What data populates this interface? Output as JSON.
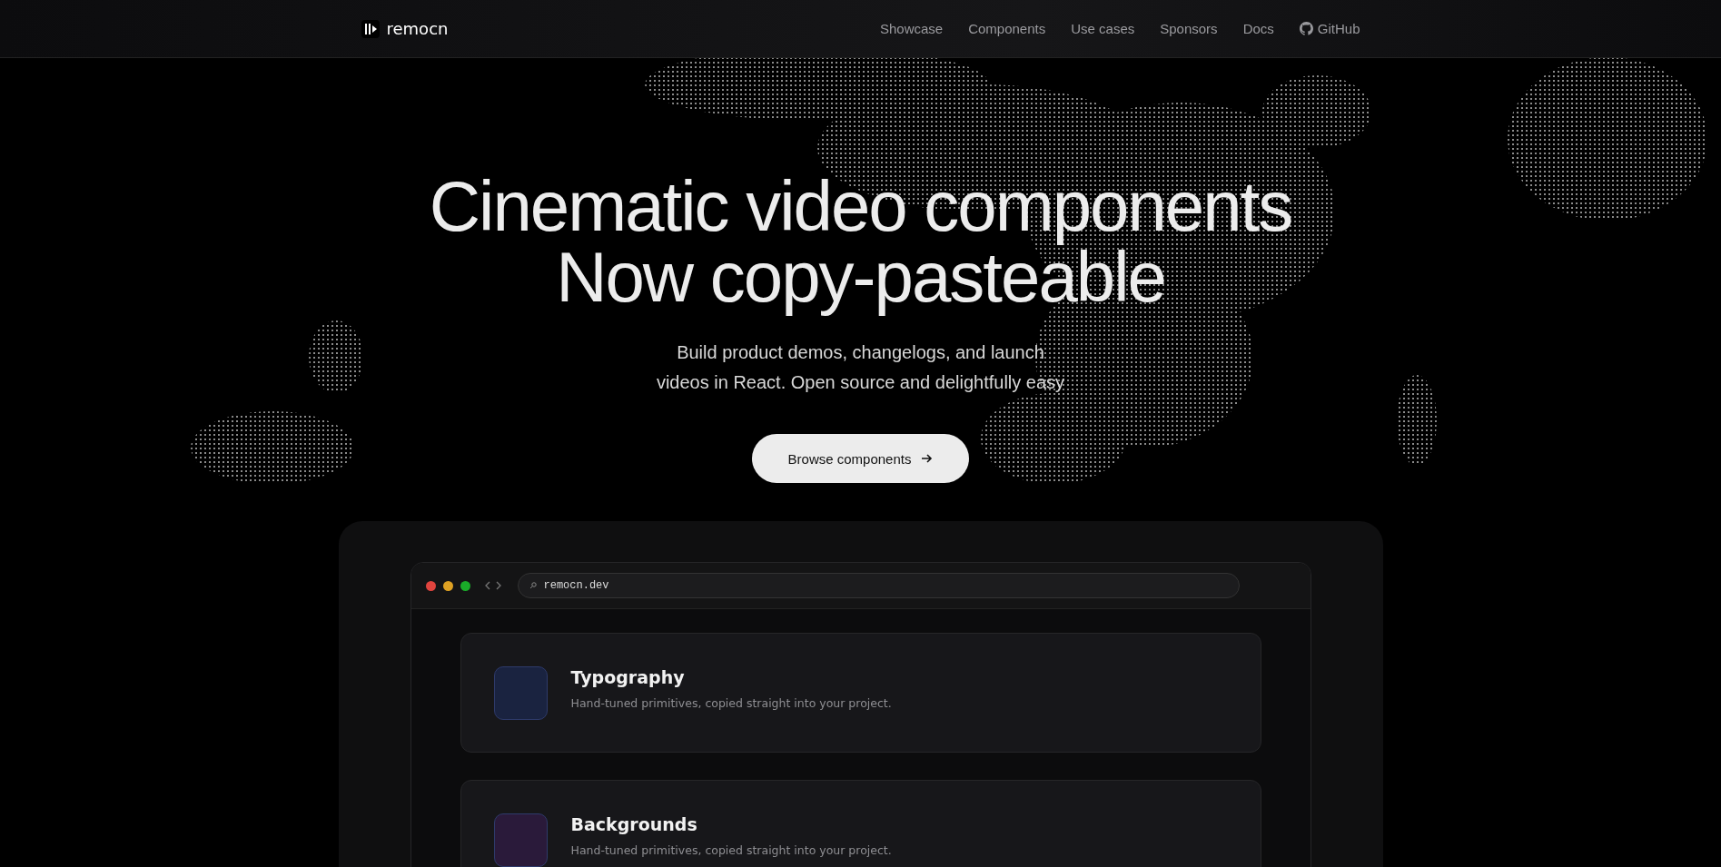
{
  "nav": {
    "brand": "remocn",
    "links": [
      {
        "label": "Showcase",
        "kind": "text"
      },
      {
        "label": "Components",
        "kind": "text"
      },
      {
        "label": "Use cases",
        "kind": "text"
      },
      {
        "label": "Sponsors",
        "kind": "text"
      },
      {
        "label": "Docs",
        "kind": "text"
      },
      {
        "label": "GitHub",
        "kind": "github"
      }
    ]
  },
  "hero": {
    "title_lines": [
      "Cinematic video components",
      "Now copy-pasteable"
    ],
    "subtitle_lines": [
      "Build product demos, changelogs, and launch",
      "videos in React. Open source and delightfully easy"
    ],
    "cta": "Browse components"
  },
  "preview": {
    "url": "remocn.dev",
    "cards": [
      {
        "title": "Typography",
        "description": "Hand-tuned primitives, copied straight into your project.",
        "color": "#1a2340"
      },
      {
        "title": "Backgrounds",
        "description": "Hand-tuned primitives, copied straight into your project.",
        "color": "#2a1a3a"
      }
    ]
  }
}
